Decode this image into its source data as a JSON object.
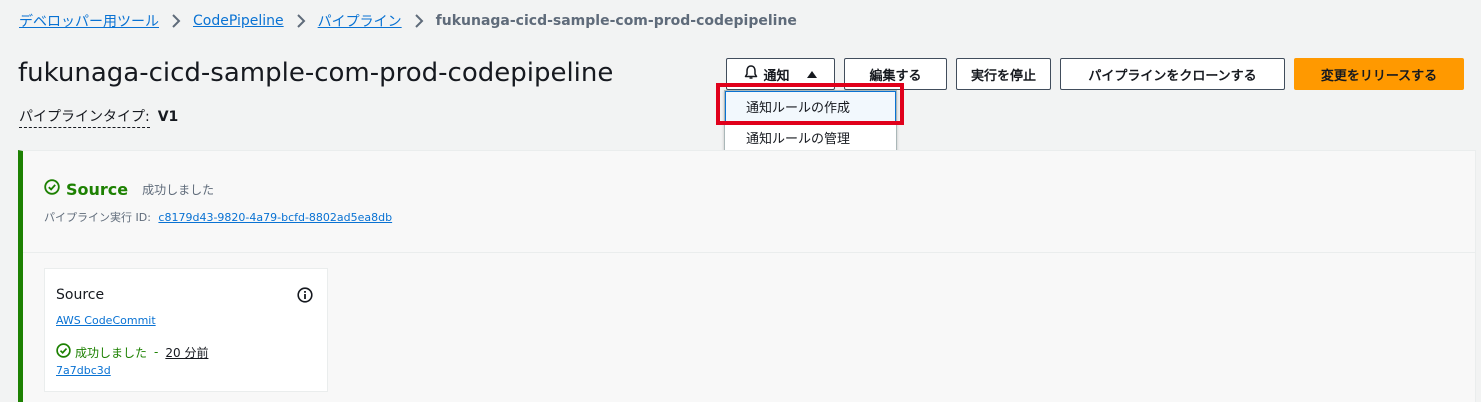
{
  "breadcrumb": {
    "items": [
      "デベロッパー用ツール",
      "CodePipeline",
      "パイプライン"
    ],
    "current": "fukunaga-cicd-sample-com-prod-codepipeline"
  },
  "header": {
    "title": "fukunaga-cicd-sample-com-prod-codepipeline",
    "pipeline_type_label": "パイプラインタイプ:",
    "pipeline_type_value": "V1"
  },
  "actions": {
    "notify": "通知",
    "edit": "編集する",
    "stop": "実行を停止",
    "clone": "パイプラインをクローンする",
    "release": "変更をリリースする"
  },
  "notify_menu": {
    "items": [
      "通知ルールの作成",
      "通知ルールの管理"
    ]
  },
  "stage": {
    "name": "Source",
    "status": "成功しました",
    "exec_label": "パイプライン実行 ID:",
    "exec_id": "c8179d43-9820-4a79-bcfd-8802ad5ea8db",
    "action": {
      "title": "Source",
      "provider": "AWS CodeCommit",
      "status": "成功しました",
      "separator": "-",
      "time": "20 分前",
      "commit": "7a7dbc3d"
    }
  },
  "colors": {
    "accent": "#0972d3",
    "success": "#1d8102",
    "primary_button": "#ff9900",
    "highlight": "#e0001b"
  }
}
